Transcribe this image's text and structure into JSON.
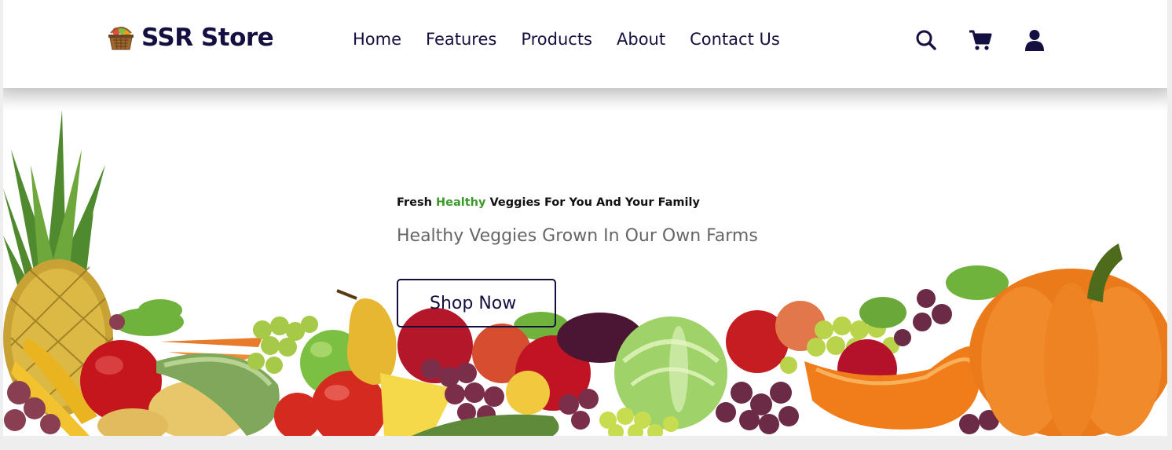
{
  "header": {
    "brand": "SSR Store",
    "brand_icon": "basket-icon",
    "nav": [
      {
        "label": "Home"
      },
      {
        "label": "Features"
      },
      {
        "label": "Products"
      },
      {
        "label": "About"
      },
      {
        "label": "Contact Us"
      }
    ],
    "icons": [
      "search-icon",
      "cart-icon",
      "user-icon"
    ]
  },
  "hero": {
    "tagline_pre": "Fresh ",
    "tagline_highlight": "Healthy",
    "tagline_post": " Veggies For You And Your Family",
    "subtitle": "Healthy Veggies Grown In Our Own Farms",
    "cta": "Shop Now"
  },
  "colors": {
    "brand": "#130f40",
    "highlight": "#3c9a2b",
    "subtitle": "#666666",
    "background": "#ffffff"
  }
}
